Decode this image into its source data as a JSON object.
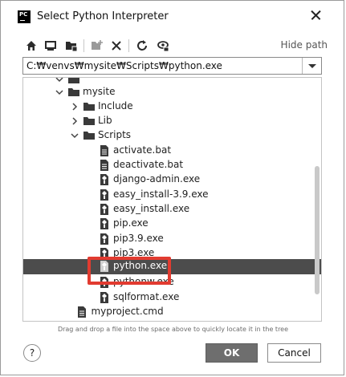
{
  "window": {
    "title": "Select Python Interpreter",
    "app_icon_text": "PC"
  },
  "toolbar": {
    "buttons": [
      "home-icon",
      "desktop-icon",
      "project-folder-icon",
      "new-folder-icon",
      "delete-icon",
      "refresh-icon",
      "show-hidden-icon"
    ],
    "hide_path_label": "Hide path"
  },
  "path": {
    "value": "C:₩venvs₩mysite₩Scripts₩python.exe"
  },
  "tree": {
    "rows": [
      {
        "label": "",
        "kind": "folder",
        "expanded": true
      },
      {
        "label": "mysite",
        "kind": "folder",
        "expanded": true
      },
      {
        "label": "Include",
        "kind": "folder",
        "expanded": false
      },
      {
        "label": "Lib",
        "kind": "folder",
        "expanded": false
      },
      {
        "label": "Scripts",
        "kind": "folder",
        "expanded": true
      },
      {
        "label": "activate.bat",
        "kind": "script-file"
      },
      {
        "label": "deactivate.bat",
        "kind": "script-file"
      },
      {
        "label": "django-admin.exe",
        "kind": "exe-file"
      },
      {
        "label": "easy_install-3.9.exe",
        "kind": "exe-file"
      },
      {
        "label": "easy_install.exe",
        "kind": "exe-file"
      },
      {
        "label": "pip.exe",
        "kind": "exe-file"
      },
      {
        "label": "pip3.9.exe",
        "kind": "exe-file"
      },
      {
        "label": "pip3.exe",
        "kind": "exe-file"
      },
      {
        "label": "python.exe",
        "kind": "exe-file",
        "selected": true
      },
      {
        "label": "pythonw.exe",
        "kind": "exe-file"
      },
      {
        "label": "sqlformat.exe",
        "kind": "exe-file"
      },
      {
        "label": "myproject.cmd",
        "kind": "script-file"
      },
      {
        "label": "",
        "kind": "script-file"
      }
    ]
  },
  "hint": "Drag and drop a file into the space above to quickly locate it in the tree",
  "buttons": {
    "help": "?",
    "ok": "OK",
    "cancel": "Cancel"
  },
  "colors": {
    "selection": "#4c4c4c",
    "highlight_border": "#e23b30",
    "ok_button": "#6e6e6e"
  }
}
